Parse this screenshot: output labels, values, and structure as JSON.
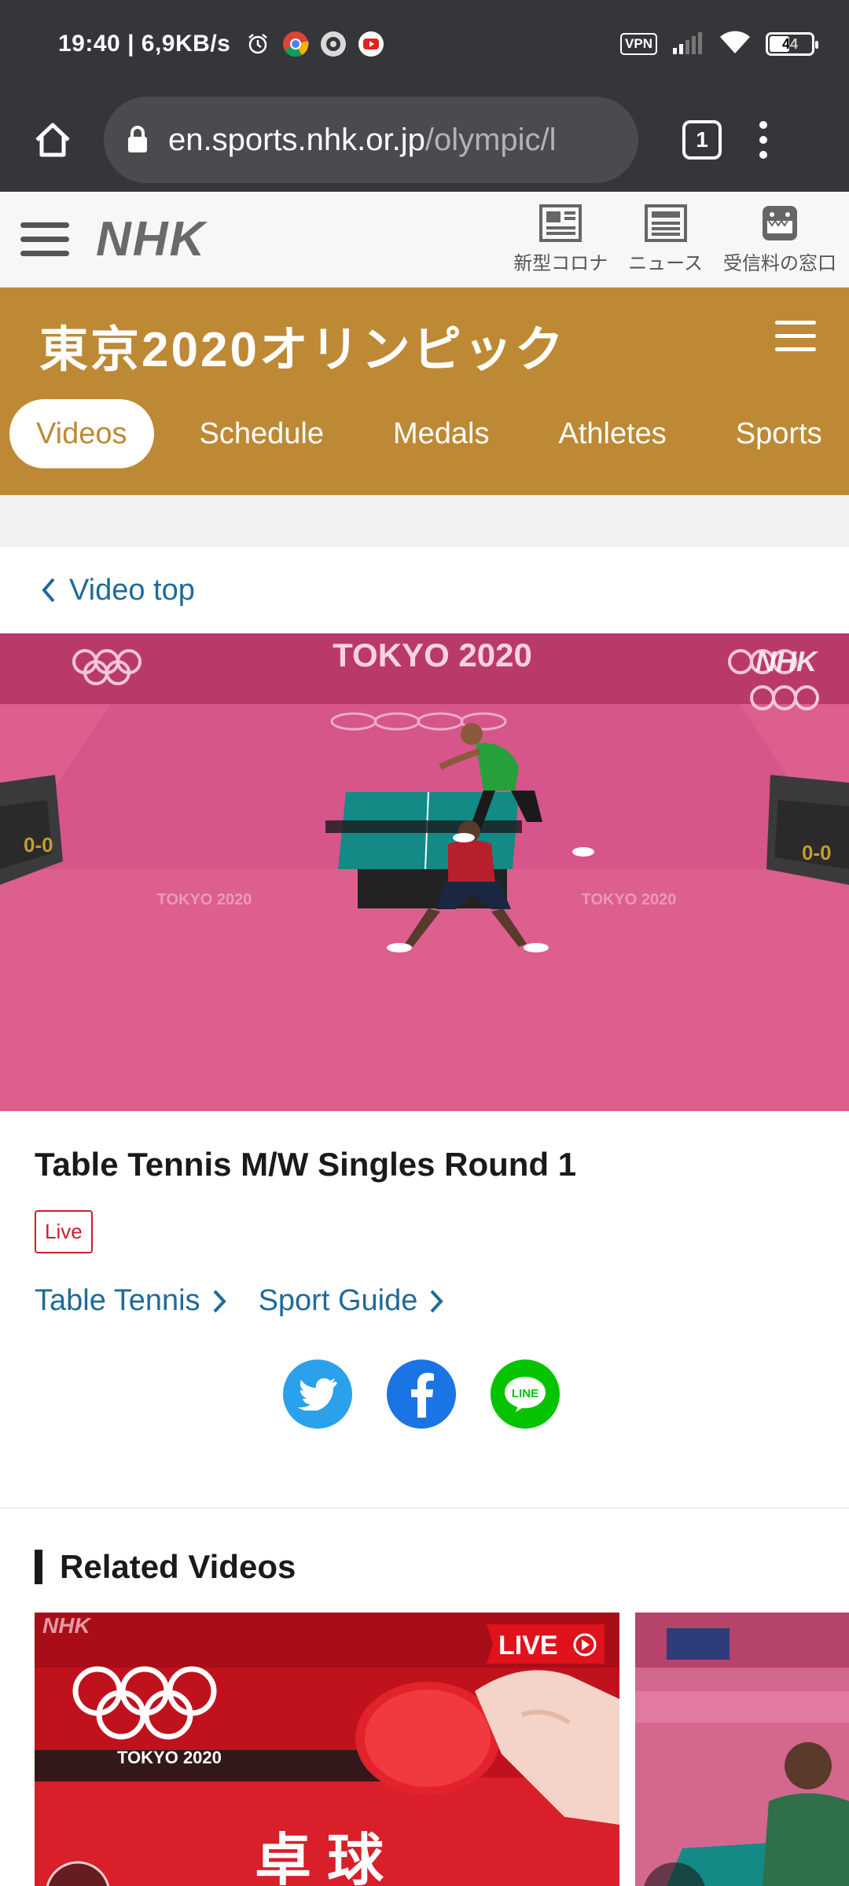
{
  "status_bar": {
    "time_speed": "19:40 | 6,9KB/s",
    "vpn": "VPN",
    "battery": "44"
  },
  "browser": {
    "url_domain": "en.sports.nhk.or.jp",
    "url_path": "/olympic/l",
    "tab_count": "1"
  },
  "nhk_header": {
    "logo": "NHK",
    "links": [
      {
        "label": "新型コロナ",
        "icon": "corona-news-icon"
      },
      {
        "label": "ニュース",
        "icon": "news-icon"
      },
      {
        "label": "受信料の窓口",
        "icon": "domo-icon"
      }
    ]
  },
  "olympic": {
    "title": "東京2020オリンピック",
    "tabs": [
      "Videos",
      "Schedule",
      "Medals",
      "Athletes",
      "Sports"
    ],
    "active_tab": "Videos"
  },
  "back_link": "Video top",
  "video": {
    "banner_text": "TOKYO 2020",
    "floor_text": "TOKYO 2020",
    "watermark": "NHK",
    "score": "0-0"
  },
  "info": {
    "title": "Table Tennis M/W Singles Round 1",
    "badge": "Live",
    "categories": [
      "Table Tennis",
      "Sport Guide"
    ]
  },
  "social": [
    "twitter",
    "facebook",
    "line"
  ],
  "related": {
    "heading": "Related Videos",
    "thumb1": {
      "watermark": "NHK",
      "live": "LIVE",
      "brand": "TOKYO 2020",
      "caption": "卓 球"
    }
  },
  "colors": {
    "olympic_gold": "#be8935",
    "link_blue": "#1f6a9a",
    "live_red": "#c9202a",
    "video_pink": "#cf4f80"
  }
}
